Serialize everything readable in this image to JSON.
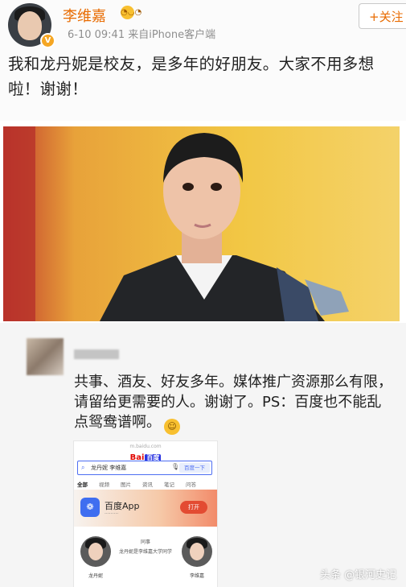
{
  "post": {
    "username": "李维嘉",
    "meta": "6-10 09:41  来自iPhone客户端",
    "follow_label": "+关注",
    "text": "我和龙丹妮是校友，是多年的好朋友。大家不用多想啦！谢谢！"
  },
  "comment": {
    "text": "共事、酒友、好友多年。媒体推广资源那么有限，请留给更需要的人。谢谢了。PS：百度也不能乱点鸳鸯谱啊。"
  },
  "baidu": {
    "logo": "Bai",
    "logo_du": "百度",
    "search_query": "龙丹妮 李维嘉",
    "search_button": "百度一下",
    "tabs": [
      "全部",
      "视频",
      "图片",
      "资讯",
      "笔记",
      "问答"
    ],
    "app_title": "百度App",
    "app_button": "打开",
    "person_left_name": "龙丹妮",
    "person_right_name": "李维嘉",
    "relation_label": "同事",
    "relation_text": "龙丹妮是李维嘉大学同学"
  },
  "watermark": "头条 @银河史记",
  "colors": {
    "username": "#e86b00",
    "photo_background": "#f0c83a",
    "comment_background": "#f5f5f5"
  }
}
